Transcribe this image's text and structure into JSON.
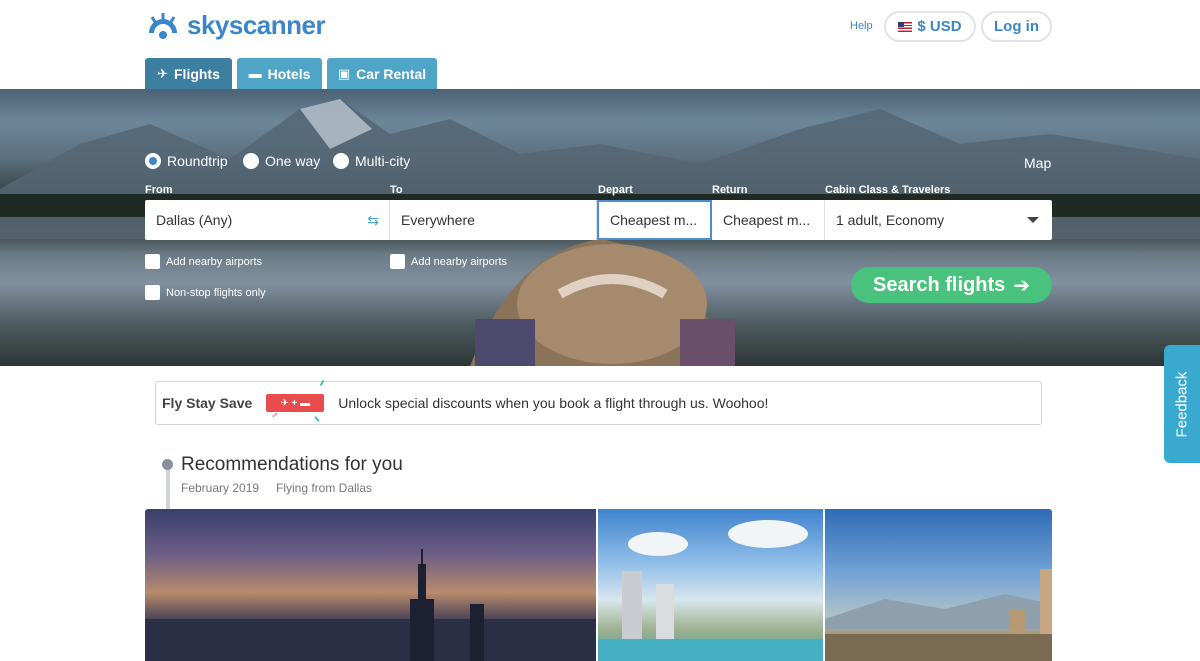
{
  "brand": {
    "name": "skyscanner",
    "color": "#3a86c8"
  },
  "header": {
    "help": "Help",
    "currency": "$ USD",
    "login": "Log in"
  },
  "tabs": [
    {
      "label": "Flights",
      "icon": "plane-icon",
      "active": true
    },
    {
      "label": "Hotels",
      "icon": "bed-icon",
      "active": false
    },
    {
      "label": "Car Rental",
      "icon": "car-icon",
      "active": false
    }
  ],
  "trip_types": [
    {
      "label": "Roundtrip",
      "selected": true
    },
    {
      "label": "One way",
      "selected": false
    },
    {
      "label": "Multi-city",
      "selected": false
    }
  ],
  "map_link": "Map",
  "form": {
    "from_label": "From",
    "from_value": "Dallas (Any)",
    "to_label": "To",
    "to_value": "Everywhere",
    "depart_label": "Depart",
    "depart_value": "Cheapest m...",
    "return_label": "Return",
    "return_value": "Cheapest m...",
    "cabin_label": "Cabin Class & Travelers",
    "cabin_value": "1 adult, Economy",
    "nearby_from": "Add nearby airports",
    "nearby_to": "Add nearby airports",
    "nonstop": "Non-stop flights only",
    "search_button": "Search flights"
  },
  "fly_stay_save": {
    "title": "Fly Stay Save",
    "text": "Unlock special discounts when you book a flight through us. Woohoo!"
  },
  "recommendations": {
    "title": "Recommendations for you",
    "date": "February 2019",
    "from": "Flying from Dallas"
  },
  "feedback": "Feedback",
  "colors": {
    "search_green": "#49c27d",
    "tab_blue": "#4ea5c8",
    "badge_red": "#e84c4c"
  }
}
